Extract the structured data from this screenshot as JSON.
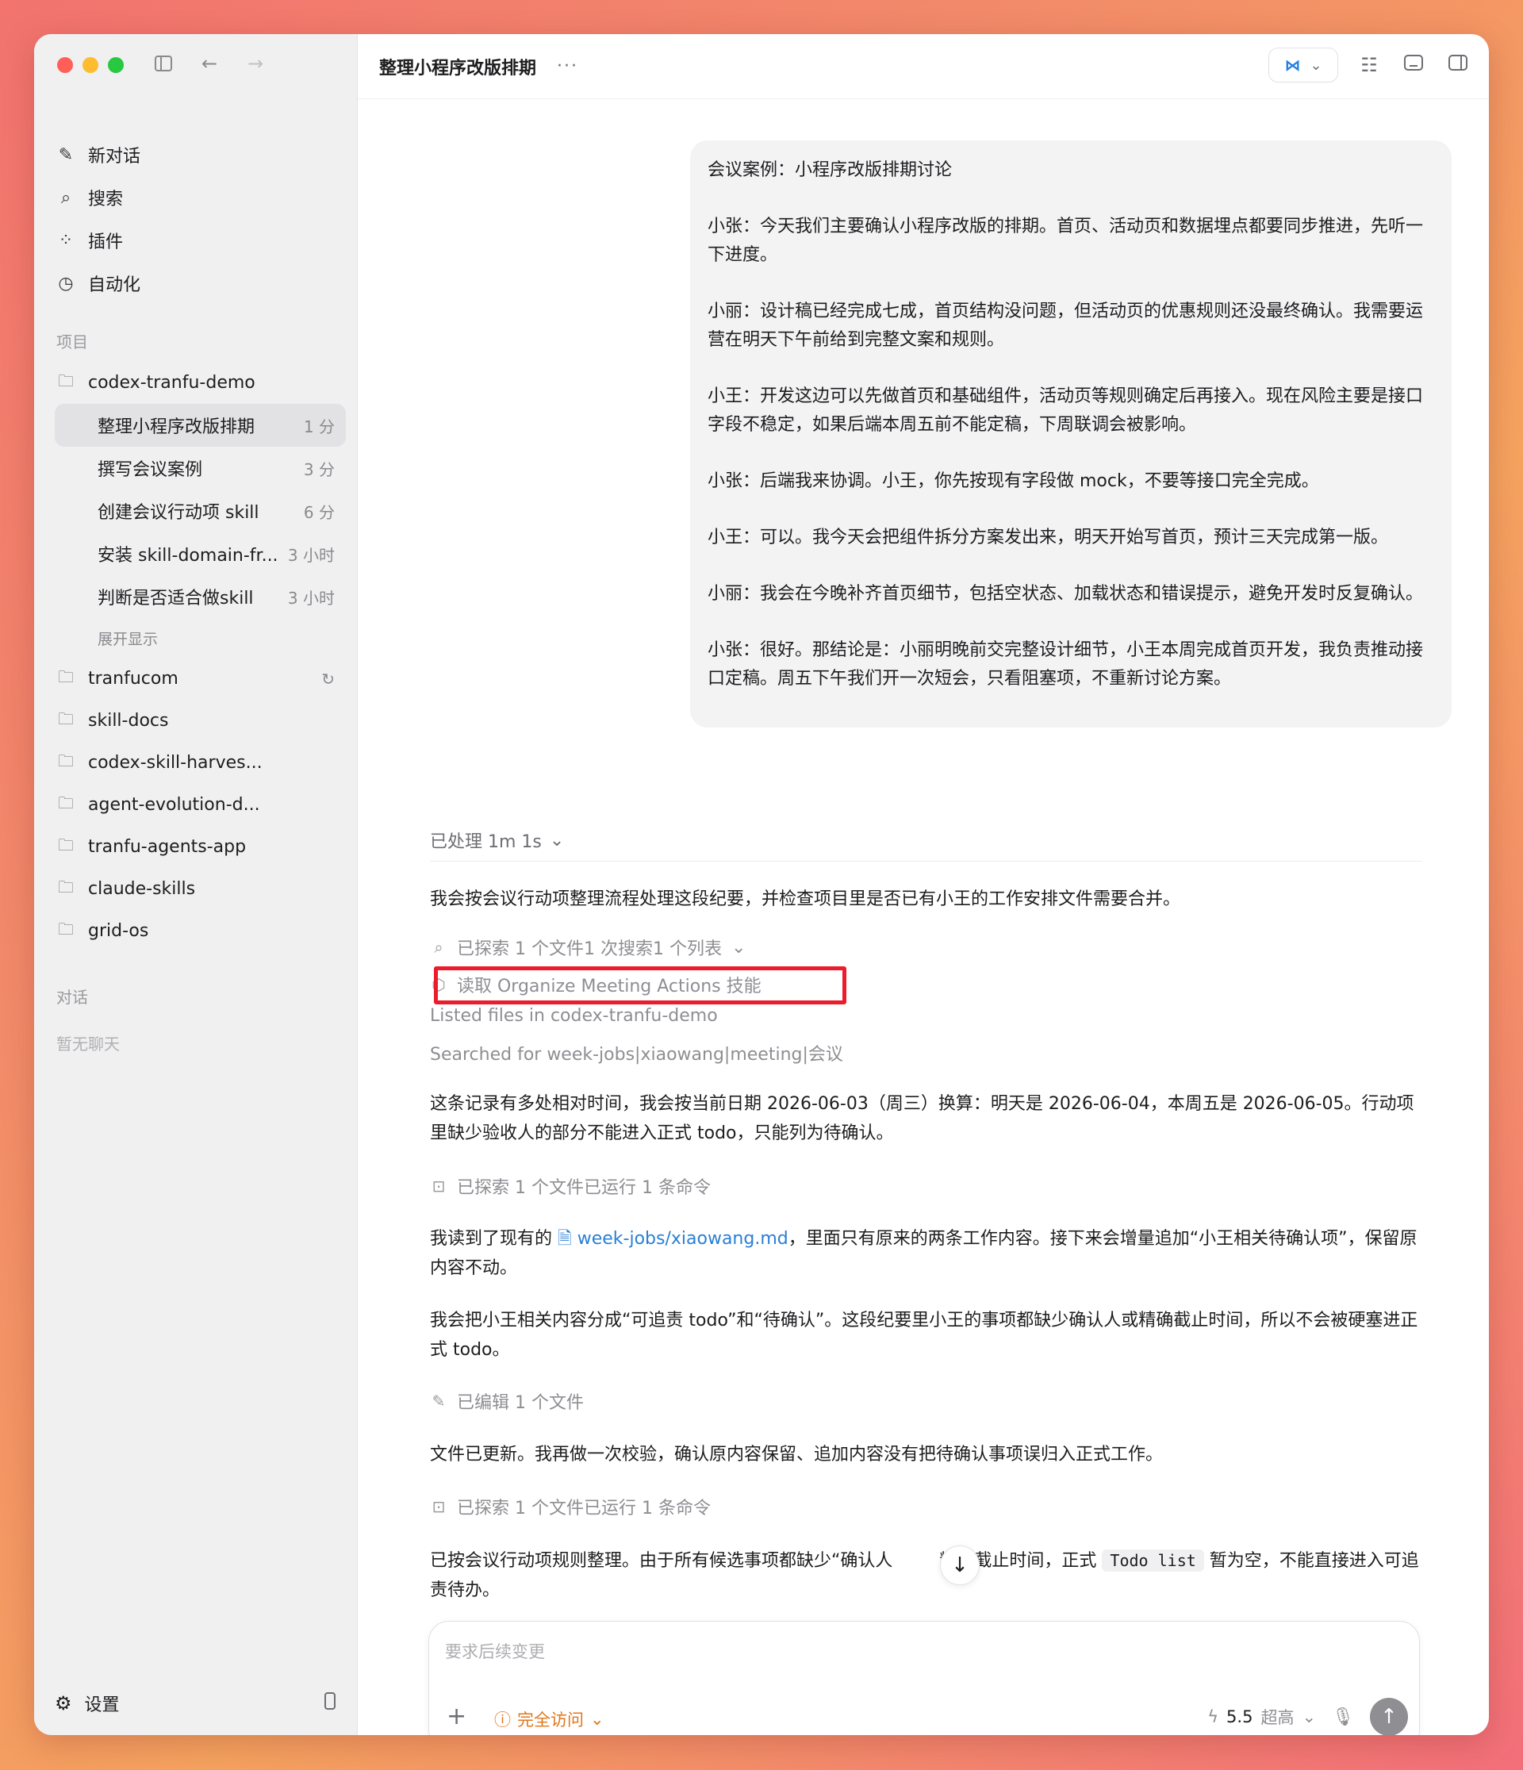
{
  "sidebar": {
    "nav": [
      {
        "icon": "edit-icon",
        "label": "新对话"
      },
      {
        "icon": "search-icon",
        "label": "搜索"
      },
      {
        "icon": "plugin-icon",
        "label": "插件"
      },
      {
        "icon": "clock-icon",
        "label": "自动化"
      }
    ],
    "projects_label": "项目",
    "current_project": "codex-tranfu-demo",
    "threads": [
      {
        "title": "整理小程序改版排期",
        "age": "1 分",
        "active": true
      },
      {
        "title": "撰写会议案例",
        "age": "3 分"
      },
      {
        "title": "创建会议行动项 skill",
        "age": "6 分"
      },
      {
        "title": "安装 skill-domain-fr...",
        "age": "3 小时"
      },
      {
        "title": "判断是否适合做skill",
        "age": "3 小时"
      }
    ],
    "expand_label": "展开显示",
    "other_projects": [
      "tranfucom",
      "skill-docs",
      "codex-skill-harves...",
      "agent-evolution-d...",
      "tranfu-agents-app",
      "claude-skills",
      "grid-os"
    ],
    "chats_label": "对话",
    "no_chats": "暂无聊天",
    "settings_label": "设置"
  },
  "topbar": {
    "title": "整理小程序改版排期",
    "more": "···"
  },
  "user_message": [
    "会议案例：小程序改版排期讨论",
    "小张：今天我们主要确认小程序改版的排期。首页、活动页和数据埋点都要同步推进，先听一下进度。",
    "小丽：设计稿已经完成七成，首页结构没问题，但活动页的优惠规则还没最终确认。我需要运营在明天下午前给到完整文案和规则。",
    "小王：开发这边可以先做首页和基础组件，活动页等规则确定后再接入。现在风险主要是接口字段不稳定，如果后端本周五前不能定稿，下周联调会被影响。",
    "小张：后端我来协调。小王，你先按现有字段做 mock，不要等接口完全完成。",
    "小王：可以。我今天会把组件拆分方案发出来，明天开始写首页，预计三天完成第一版。",
    "小丽：我会在今晚补齐首页细节，包括空状态、加载状态和错误提示，避免开发时反复确认。",
    "小张：很好。那结论是：小丽明晚前交完整设计细节，小王本周完成首页开发，我负责推动接口定稿。周五下午我们开一次短会，只看阻塞项，不重新讨论方案。"
  ],
  "assistant": {
    "processed": "已处理 1m 1s",
    "p1": "我会按会议行动项整理流程处理这段纪要，并检查项目里是否已有小王的工作安排文件需要合并。",
    "explored1": "已探索 1 个文件1 次搜索1 个列表",
    "read_skill": "读取 Organize Meeting Actions 技能",
    "listed": "Listed files in codex-tranfu-demo",
    "searched": "Searched for week-jobs|xiaowang|meeting|会议",
    "p2": "这条记录有多处相对时间，我会按当前日期 2026-06-03（周三）换算：明天是 2026-06-04，本周五是 2026-06-05。行动项里缺少验收人的部分不能进入正式 todo，只能列为待确认。",
    "explored2": "已探索 1 个文件已运行 1 条命令",
    "p3_pre": "我读到了现有的",
    "p3_link": "week-jobs/xiaowang.md",
    "p3_post": "，里面只有原来的两条工作内容。接下来会增量追加“小王相关待确认项”，保留原内容不动。",
    "p4": "我会把小王相关内容分成“可追责 todo”和“待确认”。这段纪要里小王的事项都缺少确认人或精确截止时间，所以不会被硬塞进正式 todo。",
    "edited": "已编辑 1 个文件",
    "p5": "文件已更新。我再做一次校验，确认原内容保留、追加内容没有把待确认事项误归入正式工作。",
    "explored3": "已探索 1 个文件已运行 1 条命令",
    "p6_pre": "已按会议行动项规则整理。由于所有候选事项都缺少“确认人",
    "p6_mid": "精确截止时间，正式",
    "p6_code": "Todo list",
    "p6_post": "暂为空，不能直接进入可追责待办。"
  },
  "composer": {
    "placeholder": "要求后续变更",
    "access": "完全访问",
    "model": "5.5",
    "effort": "超高"
  },
  "colors": {
    "accent_link": "#2a7fd4",
    "highlight": "#ec1c2c",
    "access": "#e0761b"
  }
}
